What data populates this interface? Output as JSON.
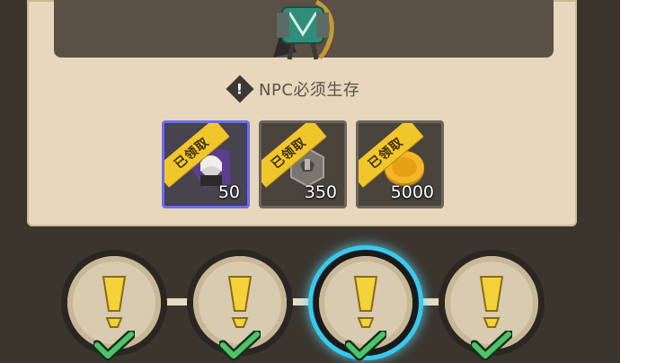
{
  "requirement": {
    "icon": "warning-diamond-icon",
    "text": "NPC必须生存"
  },
  "rewards": [
    {
      "icon": "character-portrait-icon",
      "amount": "50",
      "status": "已领取",
      "featured": true
    },
    {
      "icon": "gear-token-icon",
      "amount": "350",
      "status": "已领取",
      "featured": false
    },
    {
      "icon": "gold-coin-icon",
      "amount": "5000",
      "status": "已领取",
      "featured": false
    }
  ],
  "progress": {
    "nodes_total": 4,
    "nodes_completed": 4,
    "active_node_index": 2,
    "node_icon": "exclamation-icon",
    "complete_icon": "checkmark-icon"
  },
  "colors": {
    "ribbon": "#f1c62b",
    "active_glow": "#39c9ee",
    "panel": "#e6d7bd"
  }
}
